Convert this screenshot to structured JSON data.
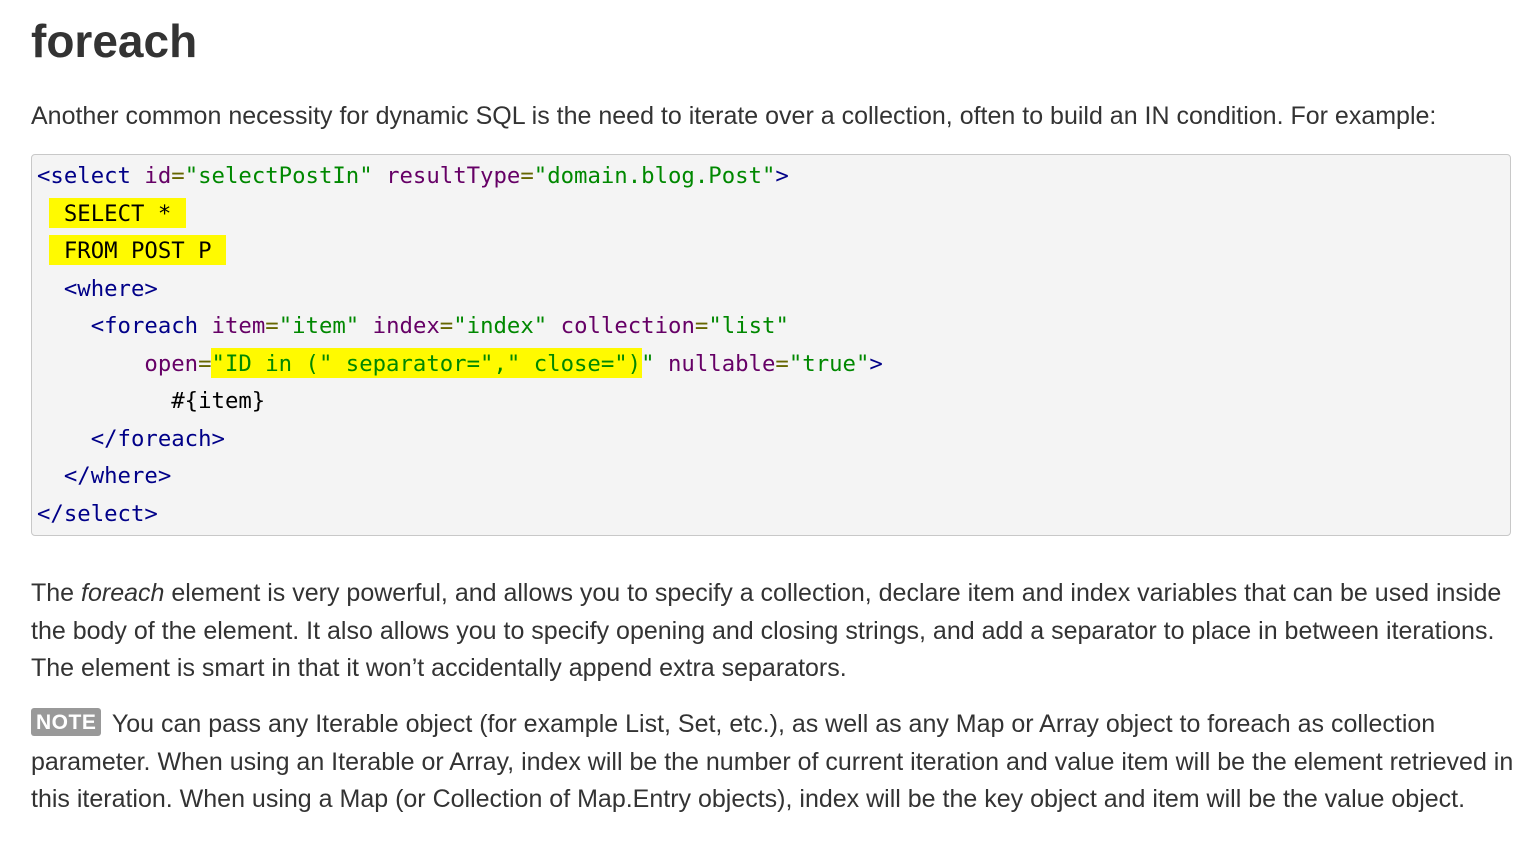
{
  "heading": "foreach",
  "intro": "Another common necessity for dynamic SQL is the need to iterate over a collection, often to build an IN condition. For example:",
  "code": {
    "l1_open": "<select",
    "l1_attr1": "id",
    "l1_eq1": "=",
    "l1_val1": "\"selectPostIn\"",
    "l1_attr2": "resultType",
    "l1_eq2": "=",
    "l1_val2": "\"domain.blog.Post\"",
    "l1_close": ">",
    "l2": "SELECT *",
    "l3": "FROM POST P",
    "l4": "<where>",
    "l5_open": "<foreach",
    "l5_attr1": "item",
    "l5_val1": "\"item\"",
    "l5_attr2": "index",
    "l5_val2": "\"index\"",
    "l5_attr3": "collection",
    "l5_val3": "\"list\"",
    "l6_attr1": "open",
    "l6_eq1": "=",
    "l6_hl": "\"ID in (\" separator=\",\" close=\")",
    "l6_rest_q": "\"",
    "l6_attr2": "nullable",
    "l6_eq2": "=",
    "l6_val2": "\"true\"",
    "l6_close": ">",
    "l7": "#{item}",
    "l8": "</foreach>",
    "l9": "</where>",
    "l10": "</select>"
  },
  "para1": {
    "pre": "The ",
    "em": "foreach",
    "post": " element is very powerful, and allows you to specify a collection, declare item and index variables that can be used inside the body of the element. It also allows you to specify opening and closing strings, and add a separator to place in between iterations. The element is smart in that it won’t accidentally append extra separators."
  },
  "note": {
    "badge": "NOTE",
    "text": " You can pass any Iterable object (for example List, Set, etc.), as well as any Map or Array object to foreach as collection parameter. When using an Iterable or Array, index will be the number of current iteration and value item will be the element retrieved in this iteration. When using a Map (or Collection of Map.Entry objects), index will be the key object and item will be the value object."
  },
  "colors": {
    "tag": "#000088",
    "attribute": "#660066",
    "string": "#008800",
    "highlight": "#fffa00",
    "badge": "#999999"
  }
}
